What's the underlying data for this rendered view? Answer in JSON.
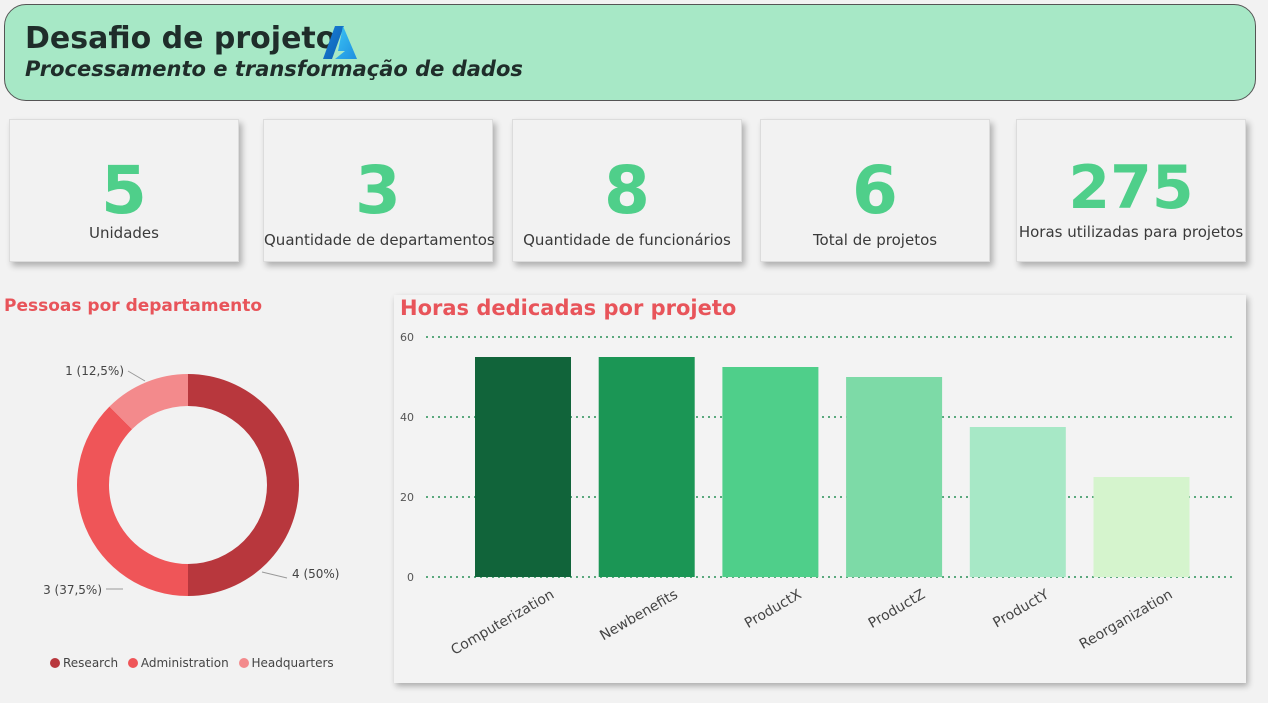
{
  "header": {
    "title": "Desafio de projeto",
    "subtitle": "Processamento e transformação de dados",
    "logo_icon": "azure-logo-icon"
  },
  "kpis": [
    {
      "value": "5",
      "label": "Unidades"
    },
    {
      "value": "3",
      "label": "Quantidade de departamentos"
    },
    {
      "value": "8",
      "label": "Quantidade de funcionários"
    },
    {
      "value": "6",
      "label": "Total de projetos"
    },
    {
      "value": "275",
      "label": "Horas utilizadas para projetos"
    }
  ],
  "colors": {
    "accent": "#4fcf8a",
    "title_red": "#e8545a",
    "header_bg": "#a7e8c6"
  },
  "chart_data": [
    {
      "type": "pie",
      "title": "Pessoas por departamento",
      "donut": true,
      "categories": [
        "Research",
        "Administration",
        "Headquarters"
      ],
      "values": [
        4,
        3,
        1
      ],
      "labels": [
        "4 (50%)",
        "3 (37,5%)",
        "1 (12,5%)"
      ],
      "colors": [
        "#b8373d",
        "#ef5558",
        "#f38a8c"
      ],
      "legend": "bottom-left"
    },
    {
      "type": "bar",
      "title": "Horas dedicadas por projeto",
      "categories": [
        "Computerization",
        "Newbenefits",
        "ProductX",
        "ProductZ",
        "ProductY",
        "Reorganization"
      ],
      "values": [
        55,
        55,
        52.5,
        50,
        37.5,
        25
      ],
      "colors": [
        "#11643a",
        "#1b9655",
        "#4fcf8a",
        "#7ddaa7",
        "#a7e8c6",
        "#d5f4cd"
      ],
      "ylim": [
        0,
        60
      ],
      "yticks": [
        0,
        20,
        40,
        60
      ],
      "grid": true
    }
  ]
}
